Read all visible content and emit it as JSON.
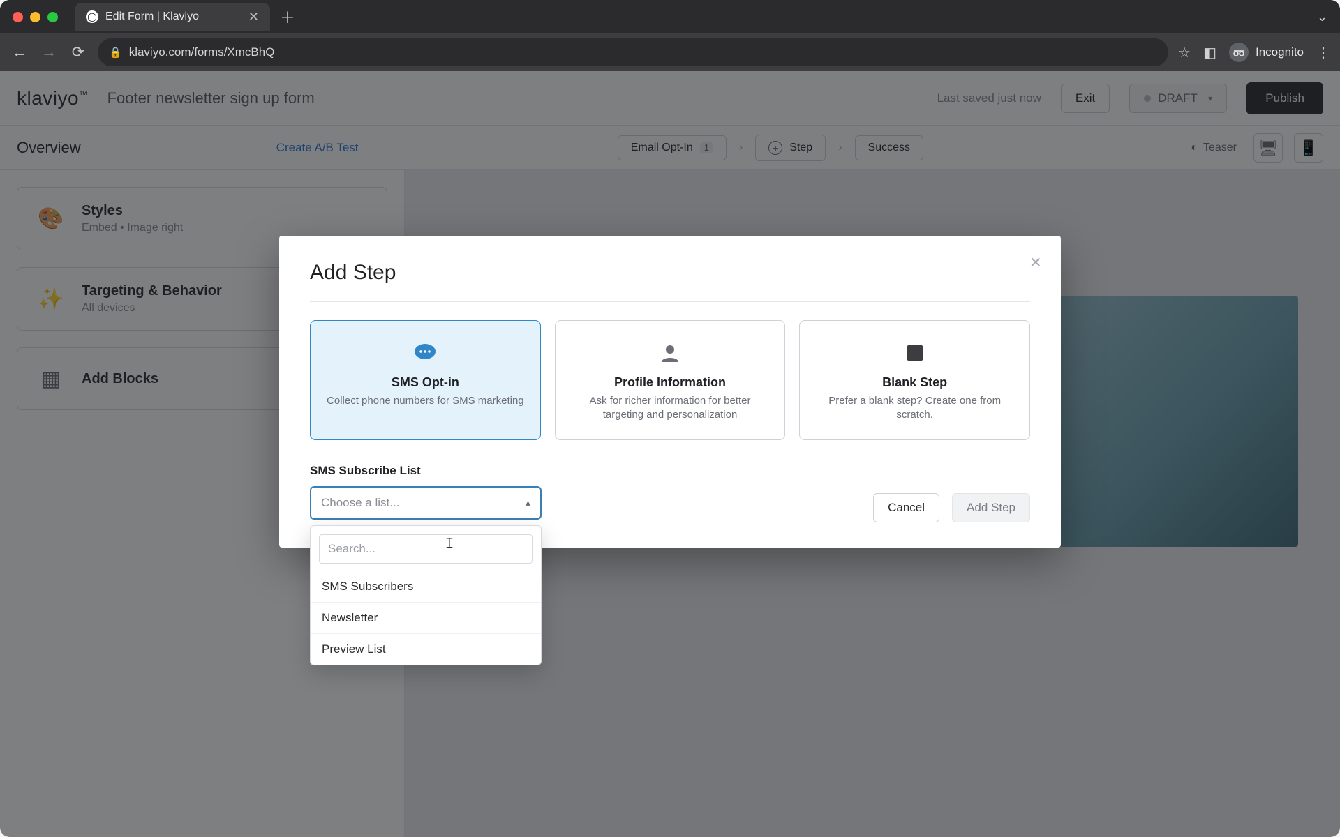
{
  "browser": {
    "tab_title": "Edit Form | Klaviyo",
    "url": "klaviyo.com/forms/XmcBhQ",
    "incognito_label": "Incognito"
  },
  "header": {
    "logo_text": "klaviyo",
    "form_title": "Footer newsletter sign up form",
    "last_saved": "Last saved just now",
    "exit_label": "Exit",
    "draft_label": "DRAFT",
    "publish_label": "Publish"
  },
  "subbar": {
    "overview": "Overview",
    "ab_test": "Create A/B Test",
    "pills": {
      "email_optin": "Email Opt-In",
      "email_badge": "1",
      "step": "Step",
      "success": "Success",
      "teaser": "Teaser"
    }
  },
  "rail": {
    "styles": {
      "title": "Styles",
      "sub": "Embed • Image right"
    },
    "targeting": {
      "title": "Targeting & Behavior",
      "sub": "All devices"
    },
    "blocks": {
      "title": "Add Blocks"
    }
  },
  "modal": {
    "title": "Add Step",
    "cards": [
      {
        "title": "SMS Opt-in",
        "desc": "Collect phone numbers for SMS marketing"
      },
      {
        "title": "Profile Information",
        "desc": "Ask for richer information for better targeting and personalization"
      },
      {
        "title": "Blank Step",
        "desc": "Prefer a blank step? Create one from scratch."
      }
    ],
    "list_label": "SMS Subscribe List",
    "select_placeholder": "Choose a list...",
    "search_placeholder": "Search...",
    "options": [
      "SMS Subscribers",
      "Newsletter",
      "Preview List"
    ],
    "cancel": "Cancel",
    "add_step": "Add Step"
  }
}
